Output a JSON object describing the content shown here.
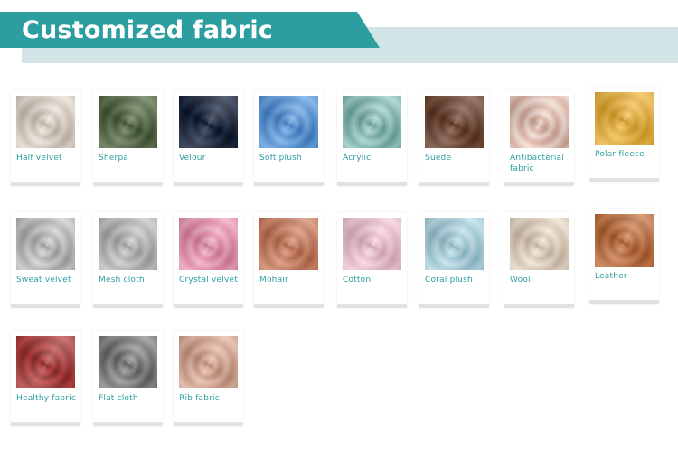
{
  "header": {
    "title": "Customized fabric"
  },
  "fabrics": [
    {
      "name": "Half velvet",
      "color": "#ece3d9",
      "color2": "#cdbfb1"
    },
    {
      "name": "Sherpa",
      "color": "#5e7449",
      "color2": "#3d5130"
    },
    {
      "name": "Velour",
      "color": "#152646",
      "color2": "#070f22"
    },
    {
      "name": "Soft plush",
      "color": "#6aa6e6",
      "color2": "#3d82cf"
    },
    {
      "name": "Acrylic",
      "color": "#9fd0cb",
      "color2": "#6aa9a4"
    },
    {
      "name": "Suede",
      "color": "#7a4a34",
      "color2": "#55301f"
    },
    {
      "name": "Antibacterial fabric",
      "color": "#d9a896",
      "color2": "#f3ddd3"
    },
    {
      "name": "Polar fleece",
      "color": "#f2bd44",
      "color2": "#e0a124"
    },
    {
      "name": "Sweat velvet",
      "color": "#cfcfcf",
      "color2": "#a8a8a8"
    },
    {
      "name": "Mesh cloth",
      "color": "#c9c9c9",
      "color2": "#a6a6a6"
    },
    {
      "name": "Crystal velvet",
      "color": "#f1a8c0",
      "color2": "#e27aa0"
    },
    {
      "name": "Mohair",
      "color": "#d98a68",
      "color2": "#b8674a"
    },
    {
      "name": "Cotton",
      "color": "#f7d1dc",
      "color2": "#e8b3c2"
    },
    {
      "name": "Coral plush",
      "color": "#bfe0ea",
      "color2": "#92c4d4"
    },
    {
      "name": "Wool",
      "color": "#f1e3d3",
      "color2": "#d6c1aa"
    },
    {
      "name": "Leather",
      "color": "#d07a45",
      "color2": "#a9592a"
    },
    {
      "name": "Healthy fabric",
      "color": "#c0413f",
      "color2": "#8f2727"
    },
    {
      "name": "Flat cloth",
      "color": "#8e8e8e",
      "color2": "#616161"
    },
    {
      "name": "Rib fabric",
      "color": "#e7b9a5",
      "color2": "#c99179"
    }
  ]
}
